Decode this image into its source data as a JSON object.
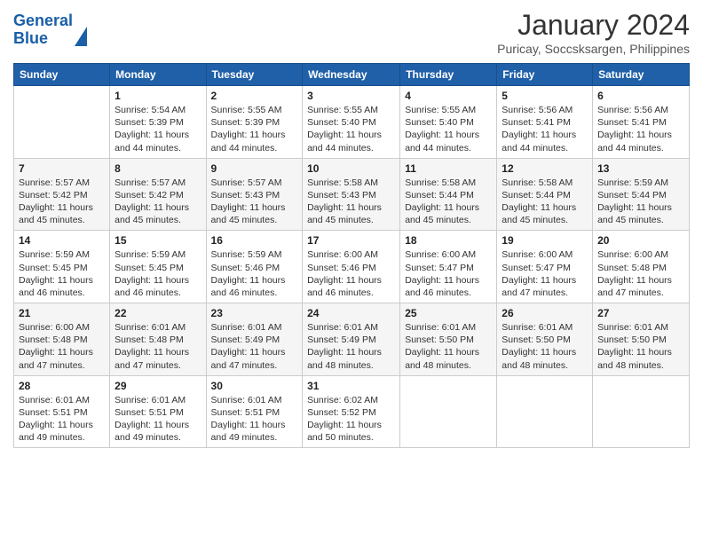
{
  "header": {
    "logo_line1": "General",
    "logo_line2": "Blue",
    "month_title": "January 2024",
    "location": "Puricay, Soccsksargen, Philippines"
  },
  "weekdays": [
    "Sunday",
    "Monday",
    "Tuesday",
    "Wednesday",
    "Thursday",
    "Friday",
    "Saturday"
  ],
  "weeks": [
    [
      {
        "day": "",
        "sunrise": "",
        "sunset": "",
        "daylight": ""
      },
      {
        "day": "1",
        "sunrise": "Sunrise: 5:54 AM",
        "sunset": "Sunset: 5:39 PM",
        "daylight": "Daylight: 11 hours and 44 minutes."
      },
      {
        "day": "2",
        "sunrise": "Sunrise: 5:55 AM",
        "sunset": "Sunset: 5:39 PM",
        "daylight": "Daylight: 11 hours and 44 minutes."
      },
      {
        "day": "3",
        "sunrise": "Sunrise: 5:55 AM",
        "sunset": "Sunset: 5:40 PM",
        "daylight": "Daylight: 11 hours and 44 minutes."
      },
      {
        "day": "4",
        "sunrise": "Sunrise: 5:55 AM",
        "sunset": "Sunset: 5:40 PM",
        "daylight": "Daylight: 11 hours and 44 minutes."
      },
      {
        "day": "5",
        "sunrise": "Sunrise: 5:56 AM",
        "sunset": "Sunset: 5:41 PM",
        "daylight": "Daylight: 11 hours and 44 minutes."
      },
      {
        "day": "6",
        "sunrise": "Sunrise: 5:56 AM",
        "sunset": "Sunset: 5:41 PM",
        "daylight": "Daylight: 11 hours and 44 minutes."
      }
    ],
    [
      {
        "day": "7",
        "sunrise": "Sunrise: 5:57 AM",
        "sunset": "Sunset: 5:42 PM",
        "daylight": "Daylight: 11 hours and 45 minutes."
      },
      {
        "day": "8",
        "sunrise": "Sunrise: 5:57 AM",
        "sunset": "Sunset: 5:42 PM",
        "daylight": "Daylight: 11 hours and 45 minutes."
      },
      {
        "day": "9",
        "sunrise": "Sunrise: 5:57 AM",
        "sunset": "Sunset: 5:43 PM",
        "daylight": "Daylight: 11 hours and 45 minutes."
      },
      {
        "day": "10",
        "sunrise": "Sunrise: 5:58 AM",
        "sunset": "Sunset: 5:43 PM",
        "daylight": "Daylight: 11 hours and 45 minutes."
      },
      {
        "day": "11",
        "sunrise": "Sunrise: 5:58 AM",
        "sunset": "Sunset: 5:44 PM",
        "daylight": "Daylight: 11 hours and 45 minutes."
      },
      {
        "day": "12",
        "sunrise": "Sunrise: 5:58 AM",
        "sunset": "Sunset: 5:44 PM",
        "daylight": "Daylight: 11 hours and 45 minutes."
      },
      {
        "day": "13",
        "sunrise": "Sunrise: 5:59 AM",
        "sunset": "Sunset: 5:44 PM",
        "daylight": "Daylight: 11 hours and 45 minutes."
      }
    ],
    [
      {
        "day": "14",
        "sunrise": "Sunrise: 5:59 AM",
        "sunset": "Sunset: 5:45 PM",
        "daylight": "Daylight: 11 hours and 46 minutes."
      },
      {
        "day": "15",
        "sunrise": "Sunrise: 5:59 AM",
        "sunset": "Sunset: 5:45 PM",
        "daylight": "Daylight: 11 hours and 46 minutes."
      },
      {
        "day": "16",
        "sunrise": "Sunrise: 5:59 AM",
        "sunset": "Sunset: 5:46 PM",
        "daylight": "Daylight: 11 hours and 46 minutes."
      },
      {
        "day": "17",
        "sunrise": "Sunrise: 6:00 AM",
        "sunset": "Sunset: 5:46 PM",
        "daylight": "Daylight: 11 hours and 46 minutes."
      },
      {
        "day": "18",
        "sunrise": "Sunrise: 6:00 AM",
        "sunset": "Sunset: 5:47 PM",
        "daylight": "Daylight: 11 hours and 46 minutes."
      },
      {
        "day": "19",
        "sunrise": "Sunrise: 6:00 AM",
        "sunset": "Sunset: 5:47 PM",
        "daylight": "Daylight: 11 hours and 47 minutes."
      },
      {
        "day": "20",
        "sunrise": "Sunrise: 6:00 AM",
        "sunset": "Sunset: 5:48 PM",
        "daylight": "Daylight: 11 hours and 47 minutes."
      }
    ],
    [
      {
        "day": "21",
        "sunrise": "Sunrise: 6:00 AM",
        "sunset": "Sunset: 5:48 PM",
        "daylight": "Daylight: 11 hours and 47 minutes."
      },
      {
        "day": "22",
        "sunrise": "Sunrise: 6:01 AM",
        "sunset": "Sunset: 5:48 PM",
        "daylight": "Daylight: 11 hours and 47 minutes."
      },
      {
        "day": "23",
        "sunrise": "Sunrise: 6:01 AM",
        "sunset": "Sunset: 5:49 PM",
        "daylight": "Daylight: 11 hours and 47 minutes."
      },
      {
        "day": "24",
        "sunrise": "Sunrise: 6:01 AM",
        "sunset": "Sunset: 5:49 PM",
        "daylight": "Daylight: 11 hours and 48 minutes."
      },
      {
        "day": "25",
        "sunrise": "Sunrise: 6:01 AM",
        "sunset": "Sunset: 5:50 PM",
        "daylight": "Daylight: 11 hours and 48 minutes."
      },
      {
        "day": "26",
        "sunrise": "Sunrise: 6:01 AM",
        "sunset": "Sunset: 5:50 PM",
        "daylight": "Daylight: 11 hours and 48 minutes."
      },
      {
        "day": "27",
        "sunrise": "Sunrise: 6:01 AM",
        "sunset": "Sunset: 5:50 PM",
        "daylight": "Daylight: 11 hours and 48 minutes."
      }
    ],
    [
      {
        "day": "28",
        "sunrise": "Sunrise: 6:01 AM",
        "sunset": "Sunset: 5:51 PM",
        "daylight": "Daylight: 11 hours and 49 minutes."
      },
      {
        "day": "29",
        "sunrise": "Sunrise: 6:01 AM",
        "sunset": "Sunset: 5:51 PM",
        "daylight": "Daylight: 11 hours and 49 minutes."
      },
      {
        "day": "30",
        "sunrise": "Sunrise: 6:01 AM",
        "sunset": "Sunset: 5:51 PM",
        "daylight": "Daylight: 11 hours and 49 minutes."
      },
      {
        "day": "31",
        "sunrise": "Sunrise: 6:02 AM",
        "sunset": "Sunset: 5:52 PM",
        "daylight": "Daylight: 11 hours and 50 minutes."
      },
      {
        "day": "",
        "sunrise": "",
        "sunset": "",
        "daylight": ""
      },
      {
        "day": "",
        "sunrise": "",
        "sunset": "",
        "daylight": ""
      },
      {
        "day": "",
        "sunrise": "",
        "sunset": "",
        "daylight": ""
      }
    ]
  ]
}
